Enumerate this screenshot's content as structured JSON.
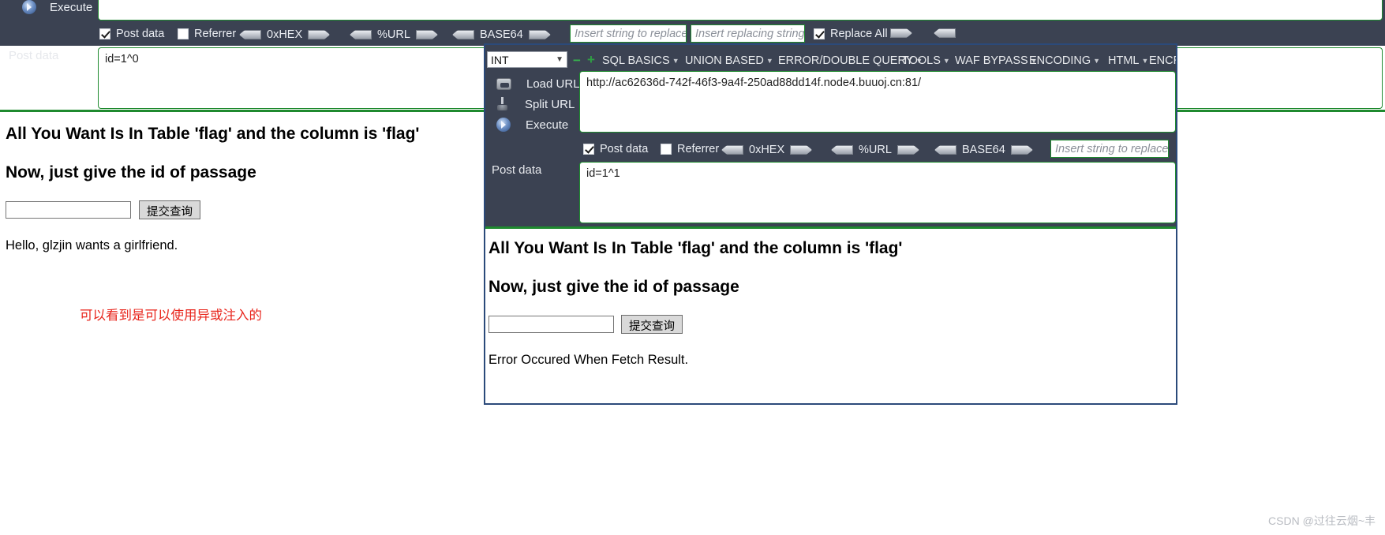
{
  "outer": {
    "toolbar": {
      "execute_label": "Execute",
      "execute_icon": "execute-play-icon",
      "post_data_label": "Post data",
      "checkboxes": [
        {
          "label": "Post data",
          "checked": true
        },
        {
          "label": "Referrer",
          "checked": false
        },
        {
          "label": "Replace All",
          "checked": true
        }
      ],
      "encoders": [
        "0xHEX",
        "%URL",
        "BASE64"
      ],
      "replace_find_placeholder": "Insert string to replace",
      "replace_with_placeholder": "Insert replacing string",
      "post_data_value": "id=1^0"
    },
    "page": {
      "heading1": "All You Want Is In Table 'flag' and the column is 'flag'",
      "heading2": "Now, just give the id of passage",
      "input_value": "",
      "submit_label": "提交查询",
      "result_text": "Hello, glzjin wants a girlfriend."
    },
    "annotation": "可以看到是可以使用异或注入的"
  },
  "inner": {
    "toolbar": {
      "type_select": "INT",
      "select_chevron": "chevron-down-icon",
      "minus_label": "−",
      "plus_label": "+",
      "menus": [
        "SQL BASICS",
        "UNION BASED",
        "ERROR/DOUBLE QUERY",
        "TOOLS",
        "WAF BYPASS",
        "ENCODING",
        "HTML",
        "ENCRY"
      ],
      "actions": [
        {
          "label": "Load URL",
          "icon": "load-url-icon"
        },
        {
          "label": "Split URL",
          "icon": "split-url-icon"
        },
        {
          "label": "Execute",
          "icon": "execute-play-icon"
        }
      ],
      "url_value": "http://ac62636d-742f-46f3-9a4f-250ad88dd14f.node4.buuoj.cn:81/",
      "post_data_label": "Post data",
      "post_data_value": "id=1^1",
      "checkboxes": [
        {
          "label": "Post data",
          "checked": true
        },
        {
          "label": "Referrer",
          "checked": false
        }
      ],
      "encoders": [
        "0xHEX",
        "%URL",
        "BASE64"
      ],
      "replace_find_placeholder": "Insert string to replace"
    },
    "page": {
      "heading1": "All You Want Is In Table 'flag' and the column is 'flag'",
      "heading2": "Now, just give the id of passage",
      "input_value": "",
      "submit_label": "提交查询",
      "result_text": "Error Occured When Fetch Result."
    }
  },
  "watermark": "CSDN @过往云烟~丰",
  "colors": {
    "toolbar_bg": "#3b4252",
    "accent_green": "#1f8a2f",
    "note_red": "#e8241b",
    "window_border": "#2b4a7a"
  }
}
